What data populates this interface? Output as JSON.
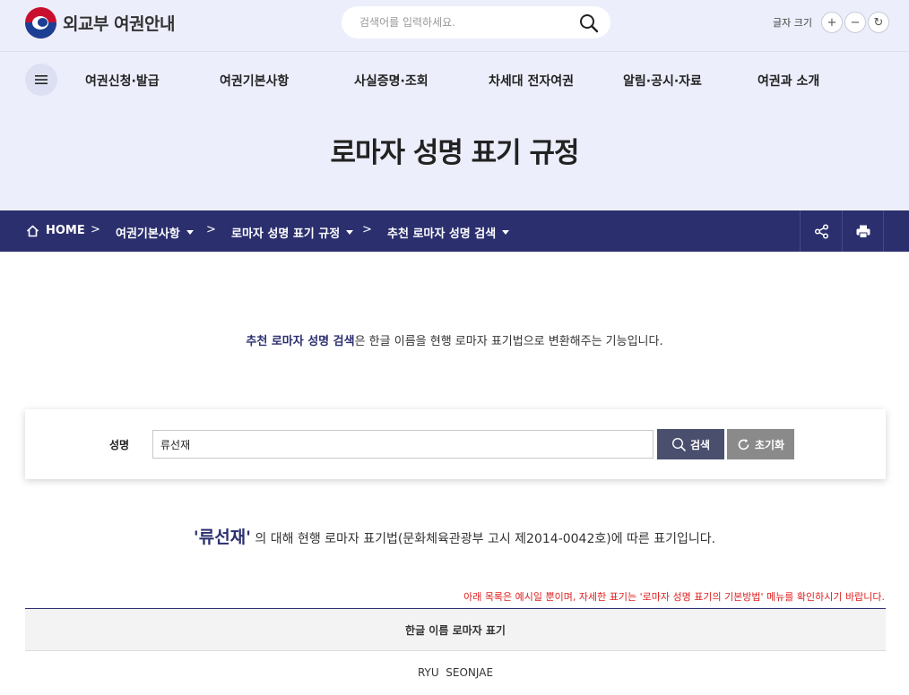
{
  "header": {
    "logo_text": "외교부 여권안내",
    "search_placeholder": "검색어를 입력하세요.",
    "font_size_label": "글자 크기",
    "font_plus": "+",
    "font_minus": "−",
    "font_reset": "↻"
  },
  "gnb": {
    "items": [
      "여권신청·발급",
      "여권기본사항",
      "사실증명·조회",
      "차세대 전자여권",
      "알림·공시·자료",
      "여권과 소개"
    ]
  },
  "page": {
    "title": "로마자 성명 표기 규정"
  },
  "breadcrumb": {
    "home": "HOME",
    "level1": "여권기본사항",
    "level2": "로마자 성명 표기 규정",
    "level3": "추천 로마자 성명 검색"
  },
  "intro": {
    "accent": "추천 로마자 성명 검색",
    "text": "은 한글 이름을 현행 로마자 표기법으로 변환해주는 기능입니다."
  },
  "search_form": {
    "label": "성명",
    "value": "류선재",
    "search_button": "검색",
    "reset_button": "초기화"
  },
  "result": {
    "name": "'류선재'",
    "text": " 의 대해 현행 로마자 표기법(문화체육관광부 고시 제2014-0042호)에 따른 표기입니다.",
    "notice": "아래 목록은 예시일 뿐이며, 자세한 표기는 '로마자 성명 표기의 기본방법' 메뉴를 확인하시기 바랍니다.",
    "table_header": "한글 이름 로마자 표기",
    "rows": [
      "RYU  SEONJAE"
    ]
  },
  "colors": {
    "primary": "#2b2f6e",
    "top_bg": "#eceefb",
    "notice": "#e02020"
  }
}
